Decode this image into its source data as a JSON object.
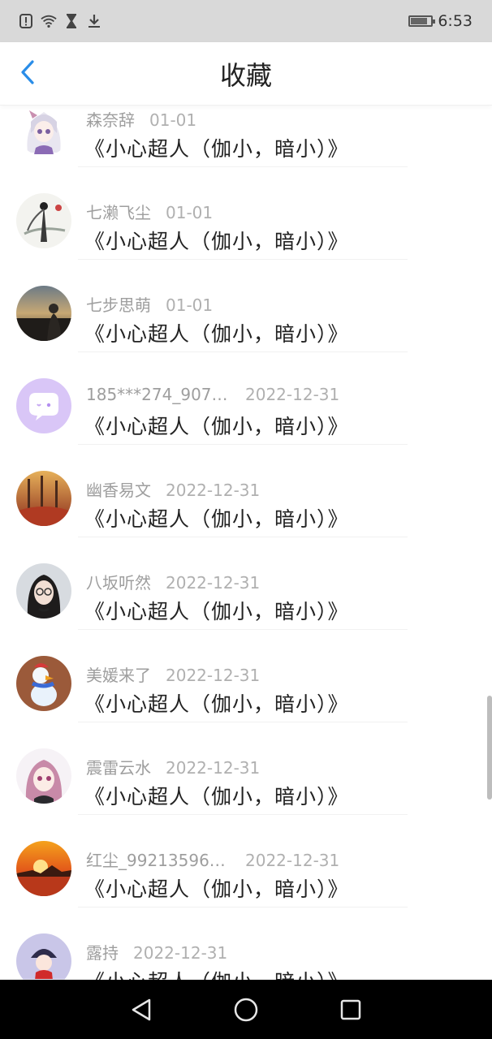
{
  "status_bar": {
    "time": "6:53",
    "battery_level": 0.8,
    "icons": [
      "alert-icon",
      "wifi-icon",
      "hourglass-icon",
      "download-icon"
    ]
  },
  "header": {
    "title": "收藏",
    "back_icon": "chevron-left-icon",
    "accent_color": "#2a8de8"
  },
  "favorites": [
    {
      "user": "森奈辞",
      "date": "01-01",
      "title": "《小心超人（伽小，暗小）》",
      "avatar": "anime-girl-white-hair"
    },
    {
      "user": "七濑飞尘",
      "date": "01-01",
      "title": "《小心超人（伽小，暗小）》",
      "avatar": "ink-painting"
    },
    {
      "user": "七步思萌",
      "date": "01-01",
      "title": "《小心超人（伽小，暗小）》",
      "avatar": "sunset-silhouette"
    },
    {
      "user": "185***274_9078...",
      "date": "2022-12-31",
      "title": "《小心超人（伽小，暗小）》",
      "avatar": "default-chat-bubble"
    },
    {
      "user": "幽香易文",
      "date": "2022-12-31",
      "title": "《小心超人（伽小，暗小）》",
      "avatar": "autumn-trees"
    },
    {
      "user": "八坂听然",
      "date": "2022-12-31",
      "title": "《小心超人（伽小，暗小）》",
      "avatar": "girl-with-glasses"
    },
    {
      "user": "美媛来了",
      "date": "2022-12-31",
      "title": "《小心超人（伽小，暗小）》",
      "avatar": "duck-toy"
    },
    {
      "user": "震雷云水",
      "date": "2022-12-31",
      "title": "《小心超人（伽小，暗小）》",
      "avatar": "anime-pink-hair"
    },
    {
      "user": "红尘_992135968...",
      "date": "2022-12-31",
      "title": "《小心超人（伽小，暗小）》",
      "avatar": "sunset-lake"
    },
    {
      "user": "露持",
      "date": "2022-12-31",
      "title": "《小心超人（伽小，暗小）》",
      "avatar": "anime-character-red"
    }
  ],
  "nav_bar": {
    "buttons": [
      "back-triangle-icon",
      "home-circle-icon",
      "recents-square-icon"
    ]
  }
}
